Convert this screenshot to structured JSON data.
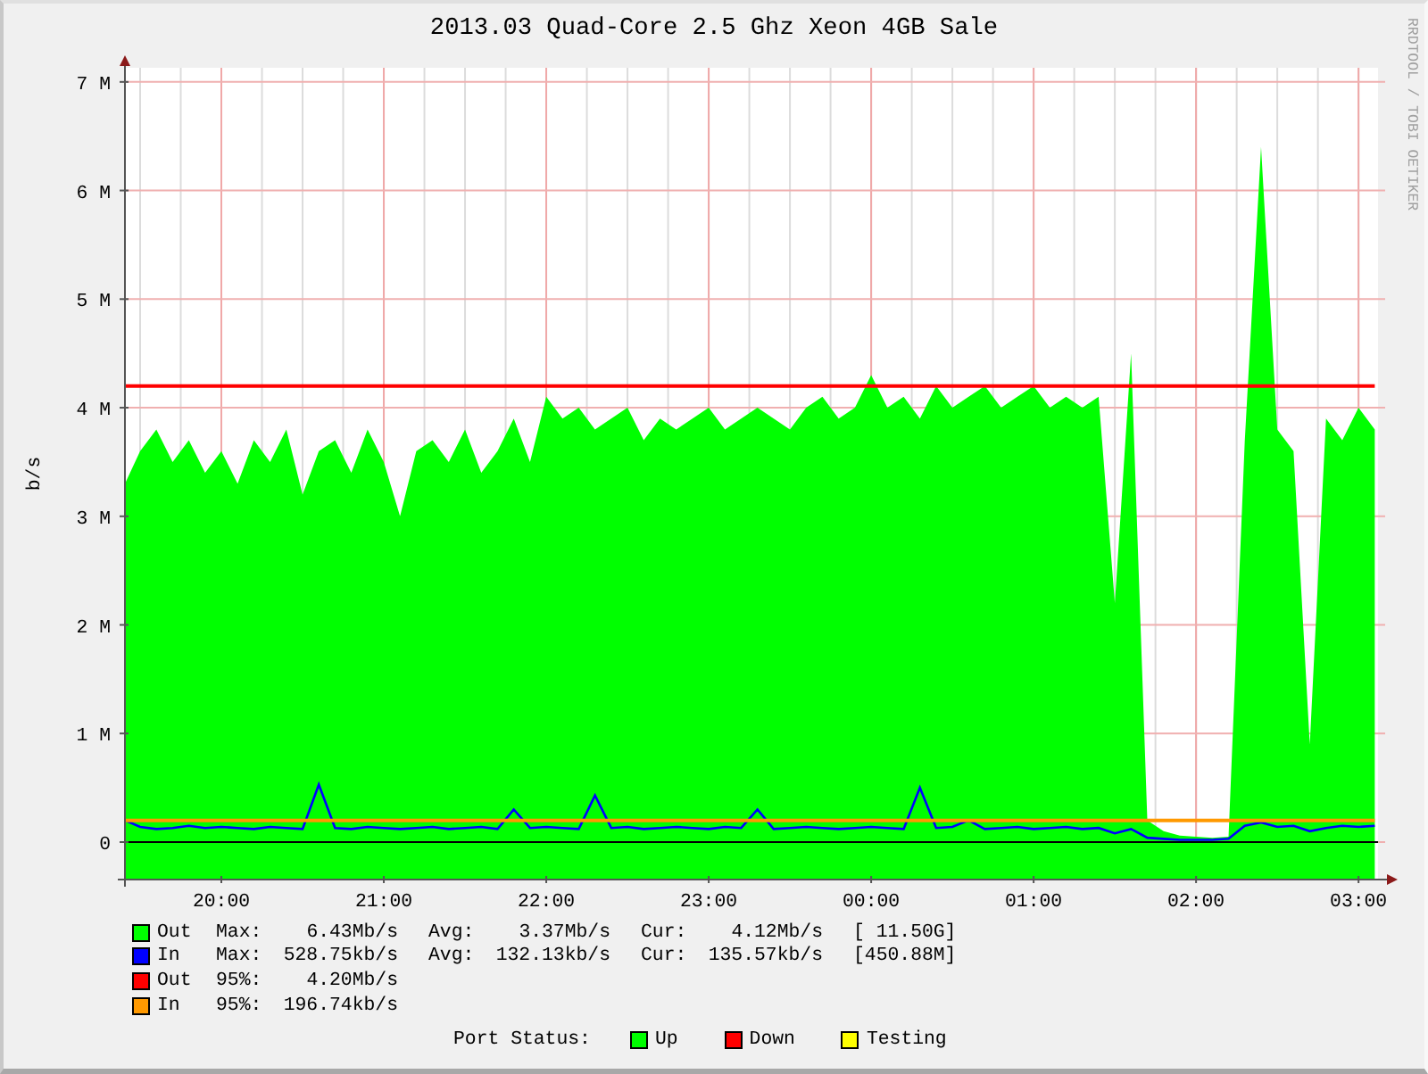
{
  "title": "2013.03 Quad-Core 2.5 Ghz Xeon 4GB Sale",
  "credit": "RRDTOOL / TOBI OETIKER",
  "chart": {
    "chart_data": {
      "type": "area",
      "ylabel": "b/s",
      "ylim": [
        -0.345,
        7.13
      ],
      "grid": true,
      "bands": [
        {
          "axis": "y",
          "from": -0.345,
          "to": 0,
          "color": "#00ff00"
        }
      ],
      "yticks": [
        {
          "value": 0,
          "label": "0"
        },
        {
          "value": 1,
          "label": "1 M"
        },
        {
          "value": 2,
          "label": "2 M"
        },
        {
          "value": 3,
          "label": "3 M"
        },
        {
          "value": 4,
          "label": "4 M"
        },
        {
          "value": 5,
          "label": "5 M"
        },
        {
          "value": 6,
          "label": "6 M"
        },
        {
          "value": 7,
          "label": "7 M"
        }
      ],
      "categories": [
        null,
        null,
        null,
        null,
        null,
        null,
        "20:00",
        null,
        null,
        null,
        null,
        null,
        null,
        null,
        null,
        null,
        "21:00",
        null,
        null,
        null,
        null,
        null,
        null,
        null,
        null,
        null,
        "22:00",
        null,
        null,
        null,
        null,
        null,
        null,
        null,
        null,
        null,
        "23:00",
        null,
        null,
        null,
        null,
        null,
        null,
        null,
        null,
        null,
        "00:00",
        null,
        null,
        null,
        null,
        null,
        null,
        null,
        null,
        null,
        "01:00",
        null,
        null,
        null,
        null,
        null,
        null,
        null,
        null,
        null,
        "02:00",
        null,
        null,
        null,
        null,
        null,
        null,
        null,
        null,
        null,
        "03:00",
        null
      ],
      "series": [
        {
          "name": "Out",
          "color": "#00ff00",
          "values": [
            3.3,
            3.6,
            3.8,
            3.5,
            3.7,
            3.4,
            3.6,
            3.3,
            3.7,
            3.5,
            3.8,
            3.2,
            3.6,
            3.7,
            3.4,
            3.8,
            3.5,
            3.0,
            3.6,
            3.7,
            3.5,
            3.8,
            3.4,
            3.6,
            3.9,
            3.5,
            4.1,
            3.9,
            4.0,
            3.8,
            3.9,
            4.0,
            3.7,
            3.9,
            3.8,
            3.9,
            4.0,
            3.8,
            3.9,
            4.0,
            3.9,
            3.8,
            4.0,
            4.1,
            3.9,
            4.0,
            4.3,
            4.0,
            4.1,
            3.9,
            4.2,
            4.0,
            4.1,
            4.2,
            4.0,
            4.1,
            4.2,
            4.0,
            4.1,
            4.0,
            4.1,
            2.2,
            4.5,
            0.2,
            0.1,
            0.06,
            0.05,
            0.04,
            0.05,
            3.7,
            6.4,
            3.8,
            3.6,
            0.9,
            3.9,
            3.7,
            4.0,
            3.8
          ]
        },
        {
          "name": "In",
          "type": "line",
          "color": "#0000ff",
          "values": [
            0.2,
            0.14,
            0.12,
            0.13,
            0.15,
            0.13,
            0.14,
            0.13,
            0.12,
            0.14,
            0.13,
            0.12,
            0.53,
            0.13,
            0.12,
            0.14,
            0.13,
            0.12,
            0.13,
            0.14,
            0.12,
            0.13,
            0.14,
            0.12,
            0.3,
            0.13,
            0.14,
            0.13,
            0.12,
            0.43,
            0.13,
            0.14,
            0.12,
            0.13,
            0.14,
            0.13,
            0.12,
            0.14,
            0.13,
            0.3,
            0.12,
            0.13,
            0.14,
            0.13,
            0.12,
            0.13,
            0.14,
            0.13,
            0.12,
            0.5,
            0.13,
            0.14,
            0.2,
            0.12,
            0.13,
            0.14,
            0.12,
            0.13,
            0.14,
            0.12,
            0.13,
            0.08,
            0.12,
            0.04,
            0.03,
            0.02,
            0.02,
            0.02,
            0.03,
            0.15,
            0.18,
            0.14,
            0.15,
            0.1,
            0.13,
            0.15,
            0.14,
            0.15
          ]
        },
        {
          "name": "Out",
          "type": "line",
          "color": "#ff0000",
          "values": [
            4.2,
            4.2,
            4.2,
            4.2,
            4.2,
            4.2,
            4.2,
            4.2,
            4.2,
            4.2,
            4.2,
            4.2,
            4.2,
            4.2,
            4.2,
            4.2,
            4.2,
            4.2,
            4.2,
            4.2,
            4.2,
            4.2,
            4.2,
            4.2,
            4.2,
            4.2,
            4.2,
            4.2,
            4.2,
            4.2,
            4.2,
            4.2,
            4.2,
            4.2,
            4.2,
            4.2,
            4.2,
            4.2,
            4.2,
            4.2,
            4.2,
            4.2,
            4.2,
            4.2,
            4.2,
            4.2,
            4.2,
            4.2,
            4.2,
            4.2,
            4.2,
            4.2,
            4.2,
            4.2,
            4.2,
            4.2,
            4.2,
            4.2,
            4.2,
            4.2,
            4.2,
            4.2,
            4.2,
            4.2,
            4.2,
            4.2,
            4.2,
            4.2,
            4.2,
            4.2,
            4.2,
            4.2,
            4.2,
            4.2,
            4.2,
            4.2,
            4.2,
            4.2
          ]
        },
        {
          "name": "In",
          "type": "line",
          "color": "#ff9900",
          "values": [
            0.2,
            0.2,
            0.2,
            0.2,
            0.2,
            0.2,
            0.2,
            0.2,
            0.2,
            0.2,
            0.2,
            0.2,
            0.2,
            0.2,
            0.2,
            0.2,
            0.2,
            0.2,
            0.2,
            0.2,
            0.2,
            0.2,
            0.2,
            0.2,
            0.2,
            0.2,
            0.2,
            0.2,
            0.2,
            0.2,
            0.2,
            0.2,
            0.2,
            0.2,
            0.2,
            0.2,
            0.2,
            0.2,
            0.2,
            0.2,
            0.2,
            0.2,
            0.2,
            0.2,
            0.2,
            0.2,
            0.2,
            0.2,
            0.2,
            0.2,
            0.2,
            0.2,
            0.2,
            0.2,
            0.2,
            0.2,
            0.2,
            0.2,
            0.2,
            0.2,
            0.2,
            0.2,
            0.2,
            0.2,
            0.2,
            0.2,
            0.2,
            0.2,
            0.2,
            0.2,
            0.2,
            0.2,
            0.2,
            0.2,
            0.2,
            0.2,
            0.2,
            0.2
          ]
        }
      ]
    }
  },
  "legend": [
    {
      "stats": [
        {
          "label": "Max:",
          "value": "6.43Mb/s"
        },
        {
          "label": "Avg:",
          "value": "3.37Mb/s"
        },
        {
          "label": "Cur:",
          "value": "4.12Mb/s"
        }
      ],
      "total": "[ 11.50G]"
    },
    {
      "stats": [
        {
          "label": "Max:",
          "value": "528.75kb/s"
        },
        {
          "label": "Avg:",
          "value": "132.13kb/s"
        },
        {
          "label": "Cur:",
          "value": "135.57kb/s"
        }
      ],
      "total": "[450.88M]"
    },
    {
      "stats": [
        {
          "label": "95%:",
          "value": "4.20Mb/s"
        }
      ]
    },
    {
      "stats": [
        {
          "label": "95%:",
          "value": "196.74kb/s"
        }
      ]
    }
  ],
  "port_status": {
    "label": "Port Status:",
    "items": [
      {
        "color": "#00ff00",
        "label": "Up"
      },
      {
        "color": "#ff0000",
        "label": "Down"
      },
      {
        "color": "#ffff00",
        "label": "Testing"
      }
    ]
  }
}
